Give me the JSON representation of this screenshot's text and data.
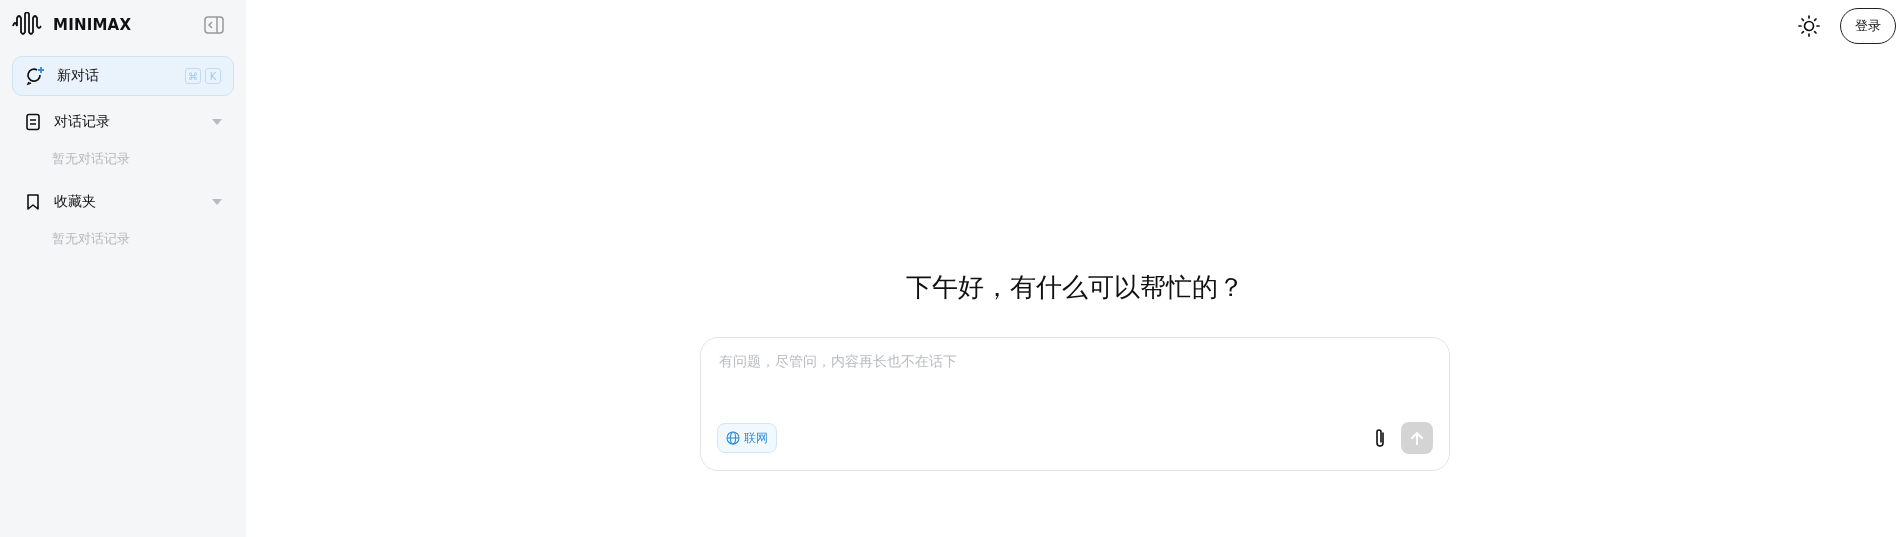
{
  "sidebar": {
    "logo": "MINIMAX",
    "new_chat": {
      "label": "新对话",
      "selected": true,
      "shortcut": [
        "⌘",
        "K"
      ]
    },
    "sections": [
      {
        "kind": "history",
        "label": "对话记录",
        "expanded": true,
        "empty_text": "暂无对话记录"
      },
      {
        "kind": "favorites",
        "label": "收藏夹",
        "expanded": true,
        "empty_text": "暂无对话记录"
      }
    ]
  },
  "header": {
    "login_button": "登录"
  },
  "main": {
    "greeting": "下午好，有什么可以帮忙的？",
    "input": {
      "placeholder": "有问题，尽管问，内容再长也不在话下"
    },
    "web_toggle": {
      "label": "联网",
      "on": true
    },
    "send_button": {
      "disabled": true
    }
  }
}
